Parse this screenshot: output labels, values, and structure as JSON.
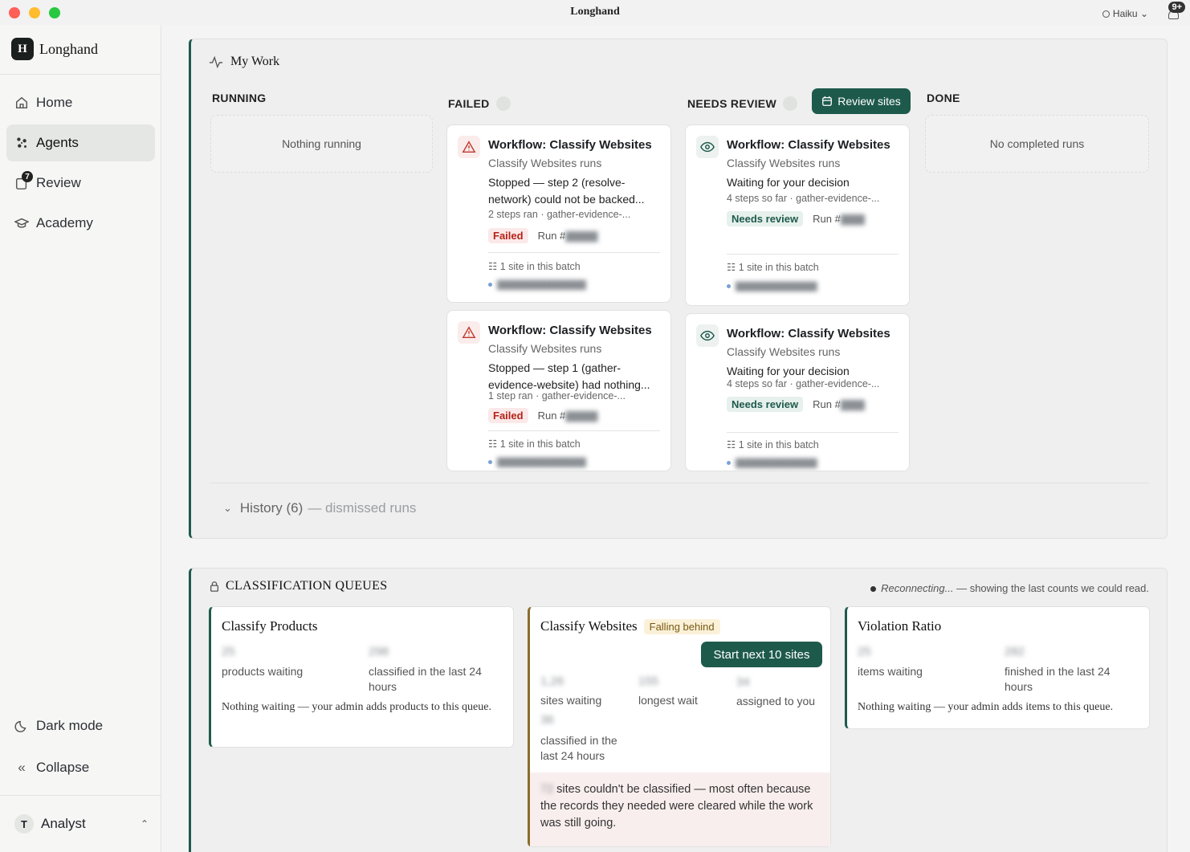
{
  "window": {
    "title": "Longhand",
    "model_label": "Haiku",
    "notif_count": "9+"
  },
  "sidebar": {
    "brand": "Longhand",
    "nav": [
      {
        "label": "Home"
      },
      {
        "label": "Agents"
      },
      {
        "label": "Review",
        "badge": "7"
      },
      {
        "label": "Academy"
      }
    ],
    "dark_mode": "Dark mode",
    "collapse": "Collapse",
    "user": {
      "initial": "T",
      "name": "Analyst"
    }
  },
  "work": {
    "title": "My Work",
    "columns": {
      "running": {
        "label": "RUNNING",
        "empty": "Nothing running"
      },
      "failed": {
        "label": "FAILED"
      },
      "review": {
        "label": "NEEDS REVIEW",
        "button": "Review sites"
      },
      "done": {
        "label": "DONE",
        "empty": "No completed runs"
      }
    },
    "failed_cards": [
      {
        "title": "Workflow: Classify Websites",
        "sub": "Classify Websites runs",
        "desc": "Stopped — step 2 (resolve-network) could not be backed...",
        "meta": "2 steps ran · gather-evidence-...",
        "status": "Failed",
        "run": "Run #",
        "batch": "1 site in this batch"
      },
      {
        "title": "Workflow: Classify Websites",
        "sub": "Classify Websites runs",
        "desc": "Stopped — step 1 (gather-evidence-website) had nothing...",
        "meta": "1 step ran · gather-evidence-...",
        "status": "Failed",
        "run": "Run #",
        "batch": "1 site in this batch"
      }
    ],
    "review_cards": [
      {
        "title": "Workflow: Classify Websites",
        "sub": "Classify Websites runs",
        "desc": "Waiting for your decision",
        "meta": "4 steps so far · gather-evidence-...",
        "status": "Needs review",
        "run": "Run #",
        "batch": "1 site in this batch"
      },
      {
        "title": "Workflow: Classify Websites",
        "sub": "Classify Websites runs",
        "desc": "Waiting for your decision",
        "meta": "4 steps so far · gather-evidence-...",
        "status": "Needs review",
        "run": "Run #",
        "batch": "1 site in this batch"
      }
    ],
    "history": {
      "label": "History (6)",
      "suffix": "— dismissed runs"
    }
  },
  "queues": {
    "title": "CLASSIFICATION QUEUES",
    "status_italic": "Reconnecting...",
    "status_rest": " — showing the last counts we could read.",
    "products": {
      "title": "Classify Products",
      "waiting_label": "products waiting",
      "classified_label": "classified in the last 24 hours",
      "note": "Nothing waiting — your admin adds products to this queue."
    },
    "websites": {
      "title": "Classify Websites",
      "badge": "Falling behind",
      "button": "Start next 10 sites",
      "waiting_label": "sites waiting",
      "longest_label": "longest wait",
      "assigned_label": "assigned to you",
      "classified_label": "classified in the last 24 hours",
      "error": "sites couldn't be classified — most often because the records they needed were cleared while the work was still going."
    },
    "violation": {
      "title": "Violation Ratio",
      "waiting_label": "items waiting",
      "finished_label": "finished in the last 24 hours",
      "note": "Nothing waiting — your admin adds items to this queue."
    }
  }
}
